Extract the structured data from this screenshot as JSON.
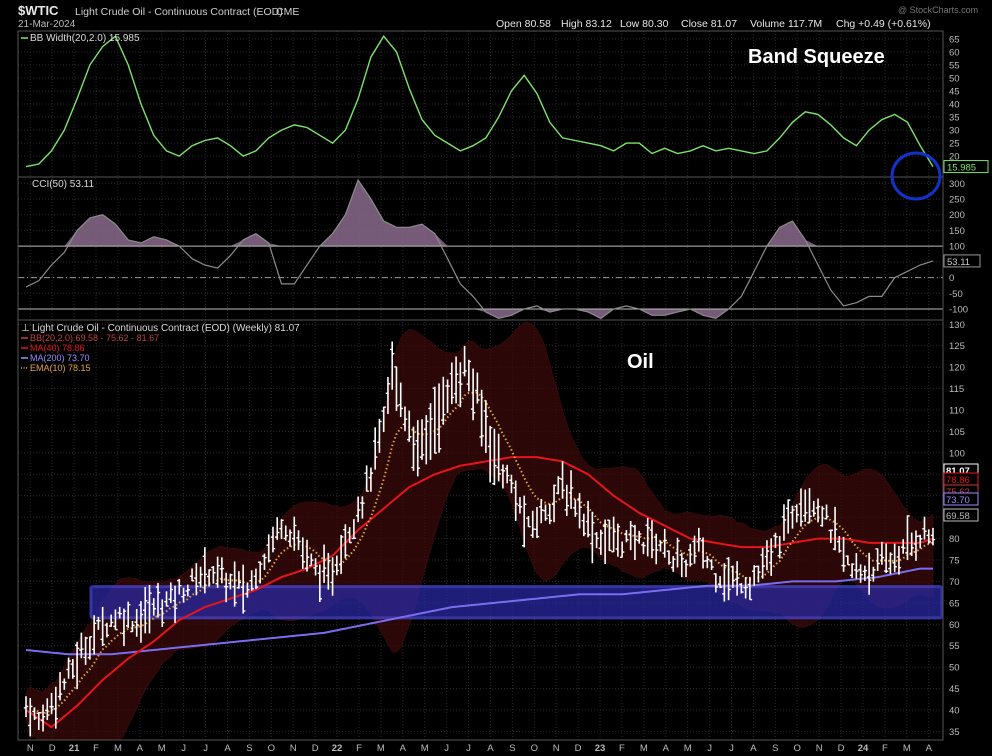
{
  "header": {
    "symbol": "$WTIC",
    "description": "Light Crude Oil - Continuous Contract (EOD)",
    "exchange": "CME",
    "date": "21-Mar-2024",
    "open": "Open 80.58",
    "high": "High 83.12",
    "low": "Low 80.30",
    "close": "Close 81.07",
    "volume": "Volume 117.7M",
    "change": "Chg +0.49 (+0.61%)",
    "watermark": "@ StockCharts.com"
  },
  "colors": {
    "background": "#000000",
    "grid": "#2a2a2a",
    "bb_width": "#7de36b",
    "cci_line": "#8c8c8c",
    "cci_fill": "#8b6b8e",
    "price_bar": "#ffffff",
    "ma40": "#e8141b",
    "ma200": "#7a6cf0",
    "ema10": "#e0a040",
    "bb_fill": "#3a0a0a",
    "support_zone": "#2a2aa8",
    "annotation_circle": "#1133cc"
  },
  "chart_data": [
    {
      "type": "line",
      "name": "bb-width-panel",
      "legend": "BB Width(20,2.0) 15.985",
      "annotation": "Band Squeeze",
      "last_value_label": "15.985",
      "yticks": [
        20,
        25,
        30,
        35,
        40,
        45,
        50,
        55,
        60,
        65
      ],
      "ylim": [
        12,
        68
      ],
      "x": [
        0,
        3,
        6,
        9,
        12,
        15,
        18,
        21,
        24,
        27,
        30,
        33,
        36,
        39,
        42,
        45,
        48,
        51,
        54,
        57,
        60,
        63,
        66,
        69,
        72,
        75,
        78,
        81,
        84,
        87,
        90,
        93,
        96,
        99,
        102,
        105,
        108,
        111,
        114,
        117,
        120,
        123,
        126,
        129,
        132,
        135,
        138,
        141,
        144,
        147,
        150,
        153,
        156,
        159,
        162,
        165,
        168,
        171,
        174,
        177,
        180,
        183,
        186,
        189,
        192,
        195,
        198,
        201,
        204,
        207,
        210,
        213
      ],
      "values": [
        16,
        17,
        22,
        30,
        42,
        55,
        62,
        66,
        55,
        40,
        28,
        22,
        20,
        24,
        26,
        27,
        24,
        20,
        22,
        27,
        30,
        32,
        31,
        28,
        25,
        30,
        42,
        58,
        66,
        60,
        46,
        34,
        28,
        25,
        22,
        24,
        27,
        35,
        45,
        51,
        44,
        33,
        27,
        26,
        25,
        24,
        22,
        25,
        25,
        21,
        23,
        21,
        22,
        24,
        22,
        23,
        22,
        21,
        22,
        27,
        33,
        37,
        36,
        32,
        27,
        24,
        30,
        34,
        36,
        33,
        24,
        16
      ]
    },
    {
      "type": "area",
      "name": "cci-panel",
      "legend": "CCI(50) 53.11",
      "last_value_label": "53.11",
      "yticks": [
        -100,
        -50,
        0,
        50,
        100,
        150,
        200,
        250,
        300
      ],
      "ylim": [
        -135,
        320
      ],
      "ref_lines": [
        100,
        0,
        -100
      ],
      "x": [
        0,
        3,
        6,
        9,
        12,
        15,
        18,
        21,
        24,
        27,
        30,
        33,
        36,
        39,
        42,
        45,
        48,
        51,
        54,
        57,
        60,
        63,
        66,
        69,
        72,
        75,
        78,
        81,
        84,
        87,
        90,
        93,
        96,
        99,
        102,
        105,
        108,
        111,
        114,
        117,
        120,
        123,
        126,
        129,
        132,
        135,
        138,
        141,
        144,
        147,
        150,
        153,
        156,
        159,
        162,
        165,
        168,
        171,
        174,
        177,
        180,
        183,
        186,
        189,
        192,
        195,
        198,
        201,
        204,
        207,
        210,
        213
      ],
      "values": [
        -30,
        -10,
        40,
        80,
        150,
        190,
        200,
        170,
        120,
        110,
        130,
        120,
        100,
        60,
        40,
        30,
        70,
        120,
        140,
        110,
        -20,
        -20,
        40,
        100,
        140,
        200,
        310,
        250,
        180,
        160,
        160,
        170,
        140,
        60,
        -20,
        -60,
        -110,
        -130,
        -120,
        -100,
        -90,
        -110,
        -100,
        -100,
        -110,
        -130,
        -100,
        -90,
        -100,
        -120,
        -120,
        -110,
        -100,
        -120,
        -130,
        -100,
        -60,
        20,
        100,
        160,
        180,
        120,
        40,
        -40,
        -90,
        -80,
        -60,
        -60,
        0,
        20,
        40,
        53
      ]
    },
    {
      "type": "ohlc",
      "name": "price-panel",
      "legend": "Light Crude Oil - Continuous Contract (EOD) (Weekly) 81.07",
      "yticks": [
        35,
        40,
        45,
        50,
        55,
        60,
        65,
        70,
        75,
        80,
        85,
        90,
        95,
        100,
        105,
        110,
        115,
        120,
        125,
        130
      ],
      "ylim": [
        33,
        131
      ],
      "xticks": [
        "N",
        "D",
        "21",
        "F",
        "M",
        "A",
        "M",
        "J",
        "J",
        "A",
        "S",
        "O",
        "N",
        "D",
        "22",
        "F",
        "M",
        "A",
        "M",
        "J",
        "J",
        "A",
        "S",
        "O",
        "N",
        "D",
        "23",
        "F",
        "M",
        "A",
        "M",
        "J",
        "J",
        "A",
        "S",
        "O",
        "N",
        "D",
        "24",
        "F",
        "M",
        "A"
      ],
      "annotation": "Oil",
      "price_labels": [
        "81.07",
        "78.86",
        "75.62",
        "73.70",
        "69.58"
      ],
      "support_zone": [
        61.5,
        68.8
      ],
      "weeks": 213,
      "anchors": [
        [
          0,
          41
        ],
        [
          3,
          37
        ],
        [
          6,
          42
        ],
        [
          10,
          48
        ],
        [
          14,
          55
        ],
        [
          18,
          60
        ],
        [
          22,
          62
        ],
        [
          26,
          61
        ],
        [
          30,
          64
        ],
        [
          34,
          66
        ],
        [
          38,
          69
        ],
        [
          43,
          73
        ],
        [
          47,
          70
        ],
        [
          52,
          68
        ],
        [
          56,
          76
        ],
        [
          60,
          84
        ],
        [
          63,
          81
        ],
        [
          67,
          74
        ],
        [
          71,
          70
        ],
        [
          75,
          80
        ],
        [
          80,
          92
        ],
        [
          84,
          106
        ],
        [
          86,
          120
        ],
        [
          88,
          112
        ],
        [
          92,
          100
        ],
        [
          96,
          108
        ],
        [
          100,
          115
        ],
        [
          103,
          120
        ],
        [
          106,
          112
        ],
        [
          110,
          100
        ],
        [
          114,
          92
        ],
        [
          118,
          82
        ],
        [
          122,
          87
        ],
        [
          126,
          92
        ],
        [
          130,
          87
        ],
        [
          134,
          80
        ],
        [
          138,
          80
        ],
        [
          142,
          79
        ],
        [
          146,
          80
        ],
        [
          150,
          78
        ],
        [
          154,
          73
        ],
        [
          158,
          78
        ],
        [
          162,
          72
        ],
        [
          166,
          70
        ],
        [
          170,
          70
        ],
        [
          174,
          74
        ],
        [
          178,
          82
        ],
        [
          182,
          90
        ],
        [
          186,
          88
        ],
        [
          190,
          80
        ],
        [
          194,
          72
        ],
        [
          198,
          73
        ],
        [
          202,
          74
        ],
        [
          206,
          77
        ],
        [
          210,
          81
        ],
        [
          213,
          81
        ]
      ],
      "series": [
        {
          "name": "BB(20,2.0) 69.58 - 75.62 - 81.67",
          "key": "bb"
        },
        {
          "name": "MA(40) 78.86",
          "key": "ma40",
          "anchors": [
            [
              0,
              40
            ],
            [
              6,
              36
            ],
            [
              12,
              41
            ],
            [
              18,
              47
            ],
            [
              24,
              52
            ],
            [
              30,
              56
            ],
            [
              36,
              61
            ],
            [
              42,
              64
            ],
            [
              48,
              66
            ],
            [
              54,
              68
            ],
            [
              60,
              71
            ],
            [
              66,
              73
            ],
            [
              72,
              76
            ],
            [
              78,
              82
            ],
            [
              84,
              87
            ],
            [
              90,
              92
            ],
            [
              96,
              95
            ],
            [
              102,
              97
            ],
            [
              108,
              98
            ],
            [
              114,
              99
            ],
            [
              120,
              99
            ],
            [
              126,
              98
            ],
            [
              132,
              95
            ],
            [
              138,
              90
            ],
            [
              144,
              86
            ],
            [
              150,
              83
            ],
            [
              156,
              80
            ],
            [
              162,
              79
            ],
            [
              168,
              78
            ],
            [
              174,
              78
            ],
            [
              180,
              79
            ],
            [
              186,
              80
            ],
            [
              192,
              80
            ],
            [
              198,
              79
            ],
            [
              204,
              79
            ],
            [
              210,
              79
            ],
            [
              213,
              80
            ]
          ]
        },
        {
          "name": "MA(200) 73.70",
          "key": "ma200",
          "anchors": [
            [
              0,
              54
            ],
            [
              10,
              53
            ],
            [
              20,
              53
            ],
            [
              30,
              54
            ],
            [
              40,
              55
            ],
            [
              50,
              56
            ],
            [
              60,
              57
            ],
            [
              70,
              58
            ],
            [
              80,
              60
            ],
            [
              90,
              62
            ],
            [
              100,
              64
            ],
            [
              110,
              65
            ],
            [
              120,
              66
            ],
            [
              130,
              67
            ],
            [
              140,
              67
            ],
            [
              150,
              68
            ],
            [
              160,
              69
            ],
            [
              170,
              69
            ],
            [
              180,
              70
            ],
            [
              190,
              70
            ],
            [
              200,
              71
            ],
            [
              210,
              73
            ],
            [
              213,
              73
            ]
          ]
        },
        {
          "name": "EMA(10) 78.15",
          "key": "ema10"
        }
      ]
    }
  ]
}
